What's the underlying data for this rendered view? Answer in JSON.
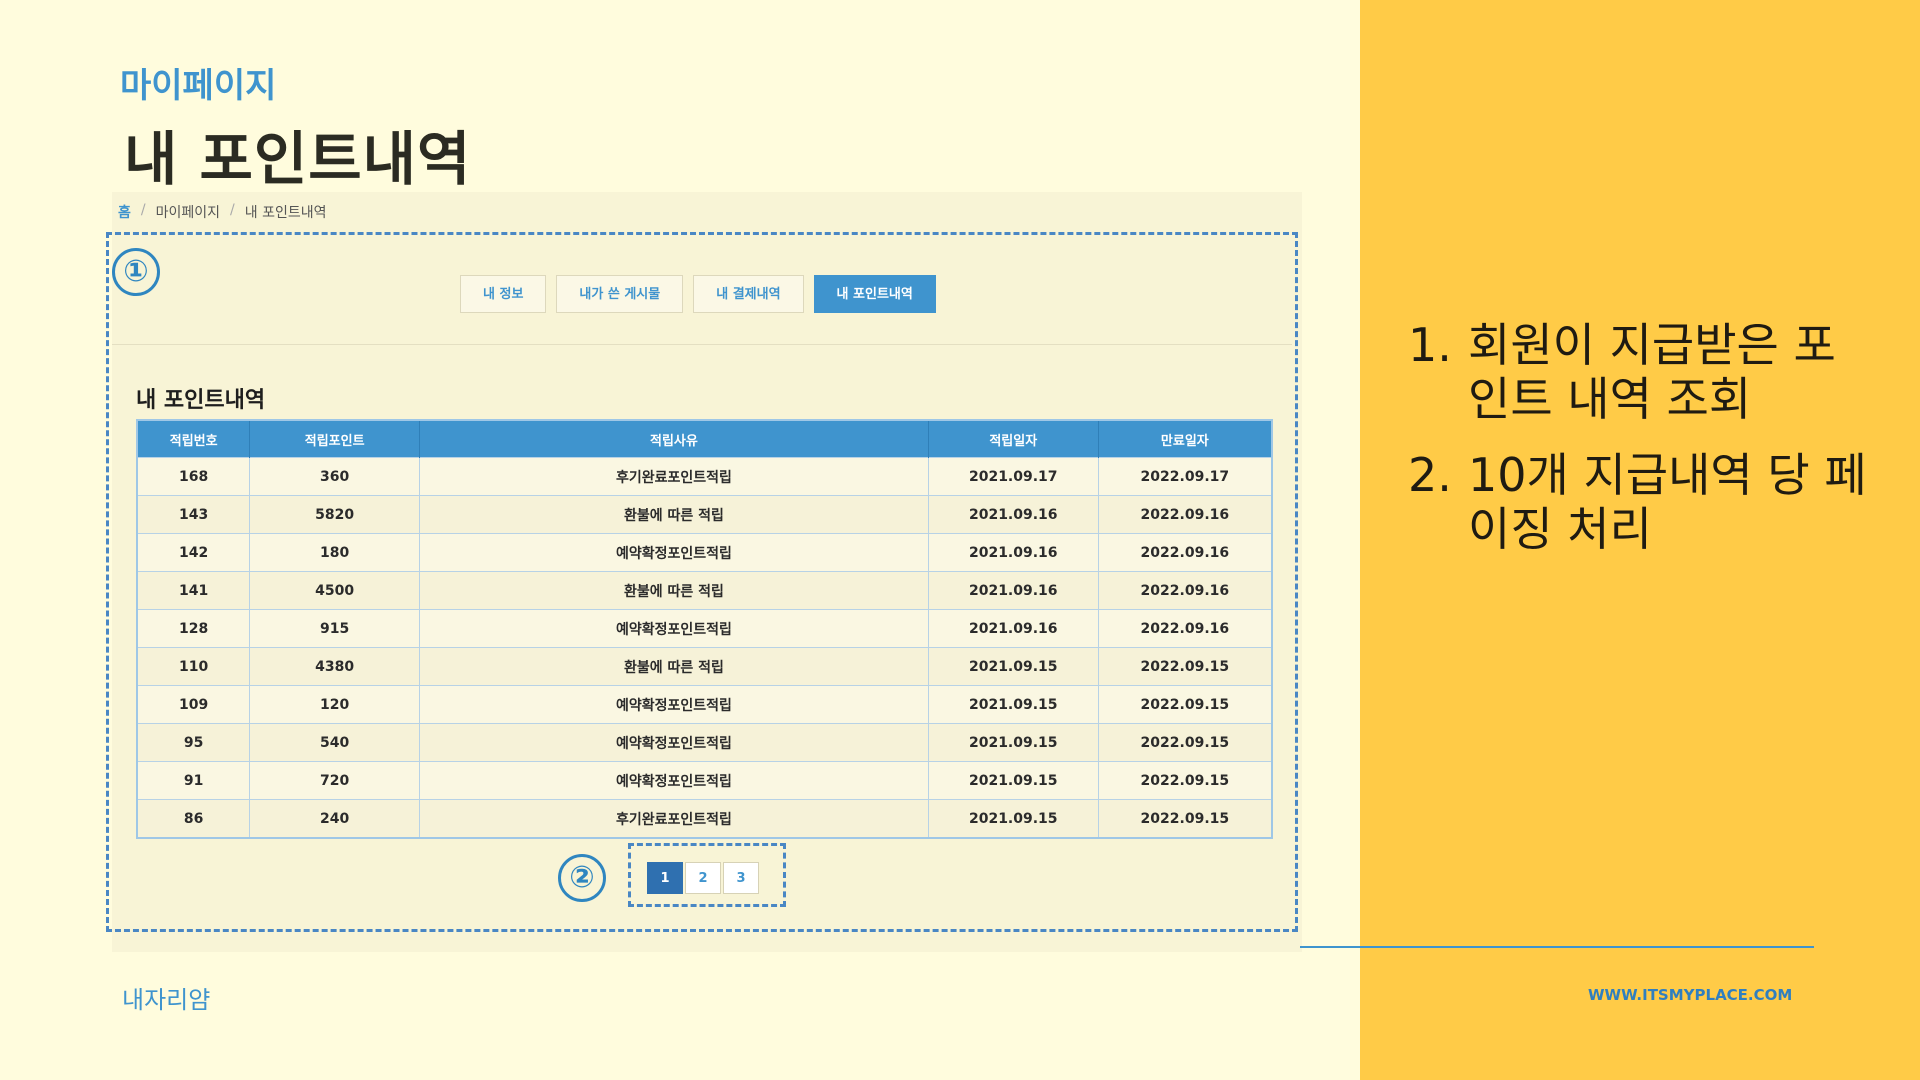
{
  "header": {
    "subtitle": "마이페이지",
    "title": "내 포인트내역"
  },
  "breadcrumb": [
    "홈",
    "마이페이지",
    "내 포인트내역"
  ],
  "annotations": {
    "one": "①",
    "two": "②"
  },
  "tabs": [
    {
      "label": "내 정보",
      "active": false
    },
    {
      "label": "내가 쓴 게시물",
      "active": false
    },
    {
      "label": "내 결제내역",
      "active": false
    },
    {
      "label": "내 포인트내역",
      "active": true
    }
  ],
  "section_title": "내 포인트내역",
  "table": {
    "columns": [
      "적립번호",
      "적립포인트",
      "적립사유",
      "적립일자",
      "만료일자"
    ],
    "rows": [
      [
        "168",
        "360",
        "후기완료포인트적립",
        "2021.09.17",
        "2022.09.17"
      ],
      [
        "143",
        "5820",
        "환불에 따른 적립",
        "2021.09.16",
        "2022.09.16"
      ],
      [
        "142",
        "180",
        "예약확정포인트적립",
        "2021.09.16",
        "2022.09.16"
      ],
      [
        "141",
        "4500",
        "환불에 따른 적립",
        "2021.09.16",
        "2022.09.16"
      ],
      [
        "128",
        "915",
        "예약확정포인트적립",
        "2021.09.16",
        "2022.09.16"
      ],
      [
        "110",
        "4380",
        "환불에 따른 적립",
        "2021.09.15",
        "2022.09.15"
      ],
      [
        "109",
        "120",
        "예약확정포인트적립",
        "2021.09.15",
        "2022.09.15"
      ],
      [
        "95",
        "540",
        "예약확정포인트적립",
        "2021.09.15",
        "2022.09.15"
      ],
      [
        "91",
        "720",
        "예약확정포인트적립",
        "2021.09.15",
        "2022.09.15"
      ],
      [
        "86",
        "240",
        "후기완료포인트적립",
        "2021.09.15",
        "2022.09.15"
      ]
    ]
  },
  "pagination": {
    "pages": [
      "1",
      "2",
      "3"
    ],
    "current": "1"
  },
  "notes": [
    {
      "num": "1.",
      "text": "회원이 지급받은 포인트 내역 조회"
    },
    {
      "num": "2.",
      "text": "10개 지급내역 당 페이징 처리"
    }
  ],
  "footer": {
    "brand": "내자리얌",
    "site": "WWW.ITSMYPLACE.COM"
  },
  "colors": {
    "background": "#FFFCDD",
    "accent_panel": "#FFCB47",
    "primary_blue": "#3F94CE"
  }
}
